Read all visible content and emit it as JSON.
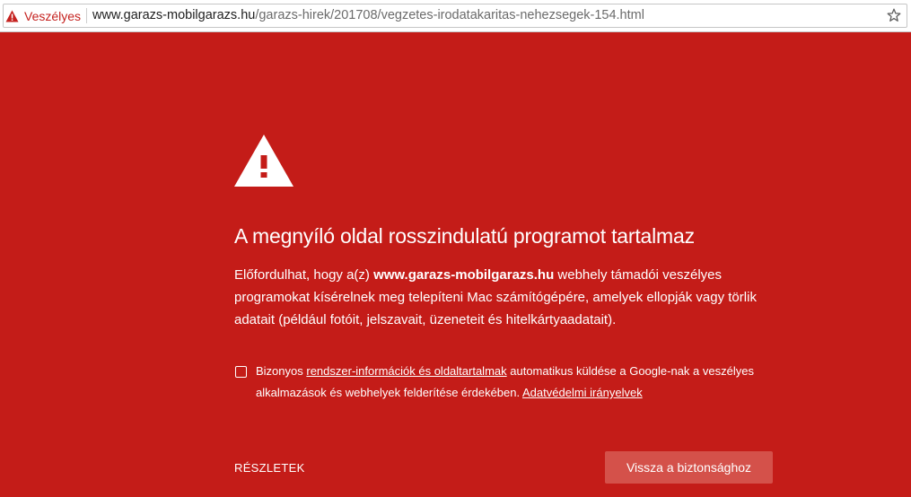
{
  "addressbar": {
    "security_label": "Veszélyes",
    "url_host": "www.garazs-mobilgarazs.hu",
    "url_path": "/garazs-hirek/201708/vegzetes-irodatakaritas-nehezsegek-154.html",
    "security_icon": "warning-triangle-icon",
    "bookmark_icon": "star-icon"
  },
  "interstitial": {
    "icon": "warning-triangle-icon",
    "heading": "A megnyíló oldal rosszindulatú programot tartalmaz",
    "body_prefix": "Előfordulhat, hogy a(z) ",
    "body_host": "www.garazs-mobilgarazs.hu",
    "body_suffix": " webhely támadói veszélyes programokat kísérelnek meg telepíteni Mac számítógépére, amelyek ellopják vagy törlik adatait (például fotóit, jelszavait, üzeneteit és hitelkártyaadatait).",
    "consent_prefix": "Bizonyos ",
    "consent_link": "rendszer-információk és oldaltartalmak",
    "consent_middle": " automatikus küldése a Google-nak a veszélyes alkalmazások és webhelyek felderítése érdekében. ",
    "privacy_link": "Adatvédelmi irányelvek",
    "details_label": "RÉSZLETEK",
    "back_button_label": "Vissza a biztonsághoz"
  },
  "colors": {
    "page_background": "#c41c18",
    "security_red": "#c5221f",
    "button_background": "#d4514a"
  }
}
